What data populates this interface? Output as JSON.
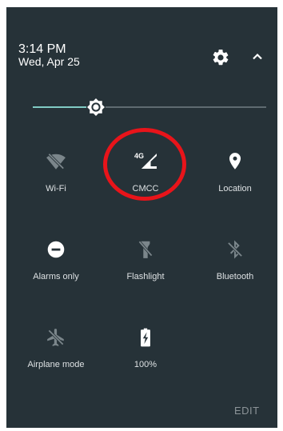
{
  "header": {
    "time": "3:14 PM",
    "date": "Wed, Apr 25",
    "settings_icon": "gear-icon",
    "collapse_icon": "chevron-up-icon"
  },
  "brightness": {
    "level": 0.27,
    "icon": "brightness-icon",
    "accent_color": "#80cbc4"
  },
  "tiles": [
    {
      "label": "Wi-Fi",
      "icon": "wifi-off-icon",
      "active": false
    },
    {
      "label": "CMCC",
      "icon": "cellular-signal-icon",
      "network_type": "4G",
      "active": true
    },
    {
      "label": "Location",
      "icon": "location-pin-icon",
      "active": true
    },
    {
      "label": "Alarms only",
      "icon": "do-not-disturb-icon",
      "active": true
    },
    {
      "label": "Flashlight",
      "icon": "flashlight-icon",
      "active": false
    },
    {
      "label": "Bluetooth",
      "icon": "bluetooth-off-icon",
      "active": false
    },
    {
      "label": "Airplane mode",
      "icon": "airplane-icon",
      "active": false
    },
    {
      "label": "100%",
      "icon": "battery-charging-icon",
      "active": true
    }
  ],
  "footer": {
    "edit_label": "EDIT"
  },
  "annotation": {
    "shape": "ellipse",
    "color": "#e8141a",
    "target": "CMCC"
  }
}
